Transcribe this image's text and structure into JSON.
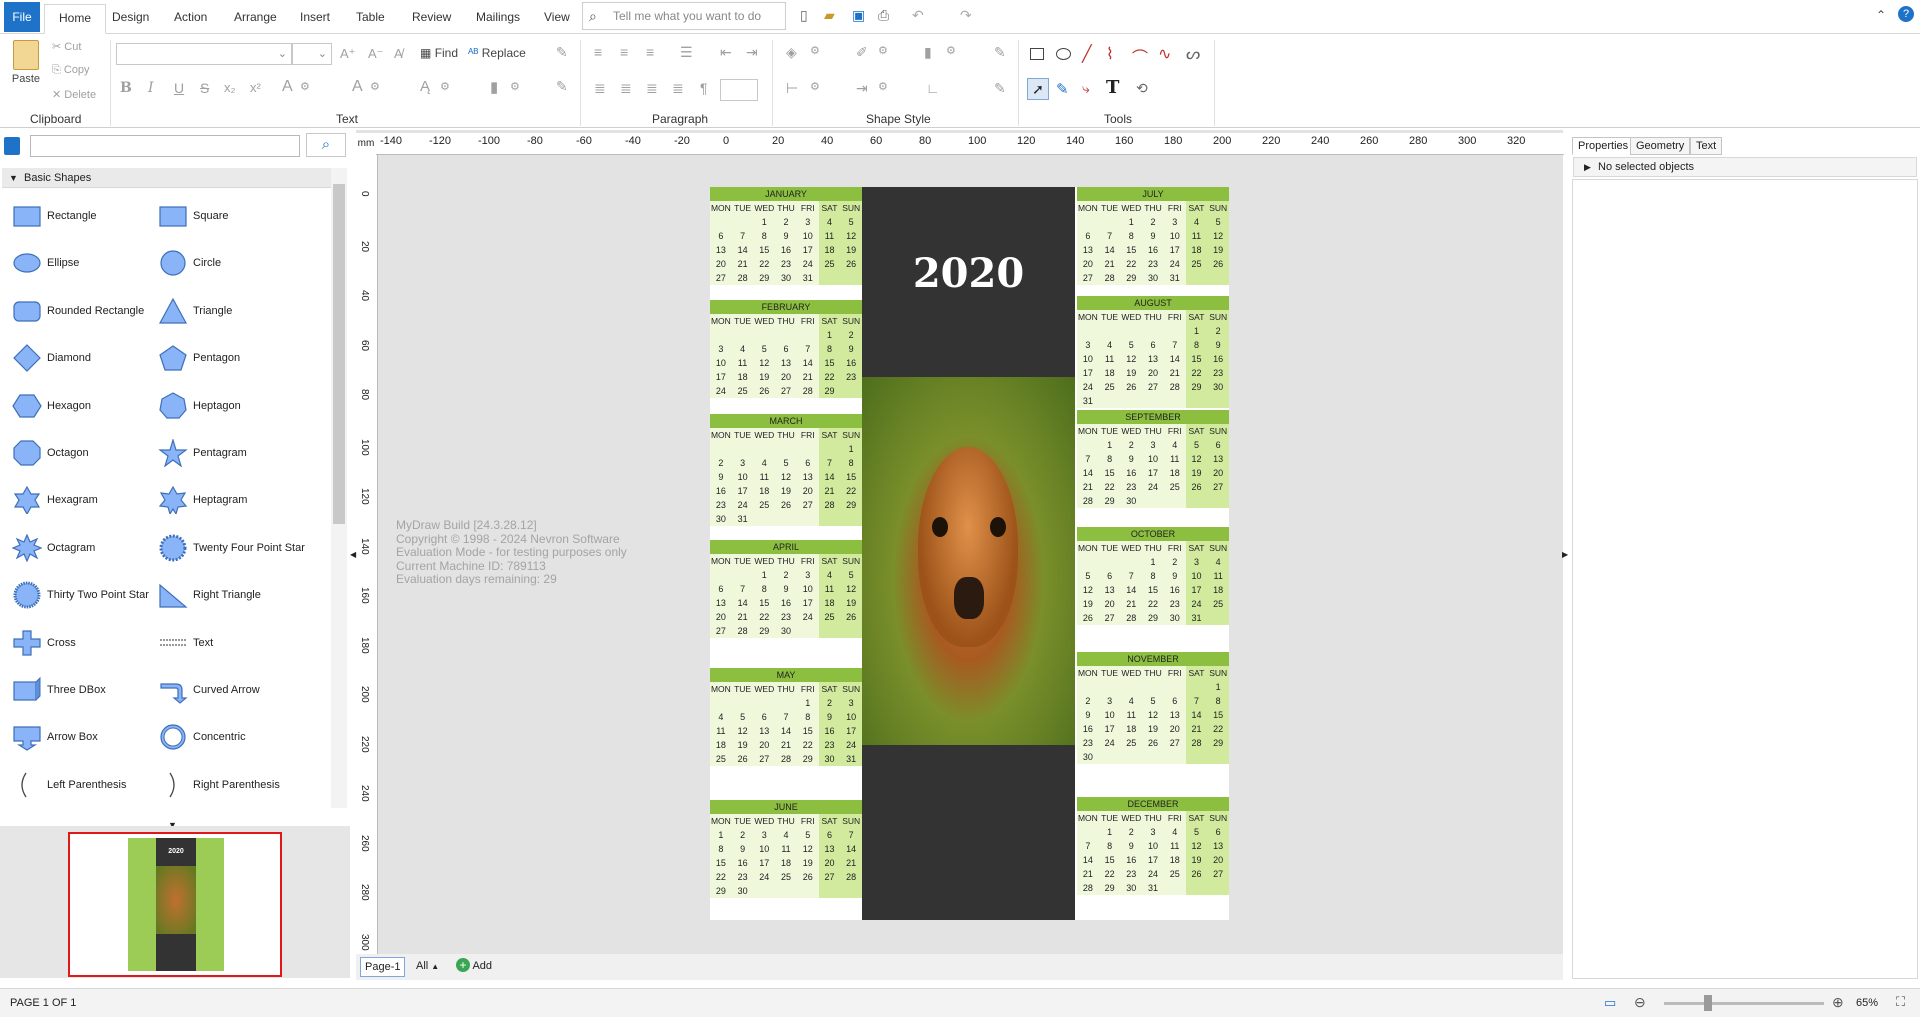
{
  "menu": {
    "file": "File",
    "tabs": [
      "Home",
      "Design",
      "Action",
      "Arrange",
      "Insert",
      "Table",
      "Review",
      "Mailings",
      "View"
    ],
    "tell_me_placeholder": "Tell me what you want to do"
  },
  "ribbon": {
    "clipboard": {
      "paste": "Paste",
      "cut": "Cut",
      "copy": "Copy",
      "delete": "Delete",
      "label": "Clipboard"
    },
    "text": {
      "find": "Find",
      "replace": "Replace",
      "label": "Text"
    },
    "paragraph": {
      "label": "Paragraph"
    },
    "shape_style": {
      "label": "Shape Style"
    },
    "tools": {
      "label": "Tools"
    }
  },
  "library": {
    "search_value": "",
    "header": "Basic Shapes",
    "shapes": [
      {
        "left": "Rectangle",
        "right": "Square"
      },
      {
        "left": "Ellipse",
        "right": "Circle"
      },
      {
        "left": "Rounded Rectangle",
        "right": "Triangle"
      },
      {
        "left": "Diamond",
        "right": "Pentagon"
      },
      {
        "left": "Hexagon",
        "right": "Heptagon"
      },
      {
        "left": "Octagon",
        "right": "Pentagram"
      },
      {
        "left": "Hexagram",
        "right": "Heptagram"
      },
      {
        "left": "Octagram",
        "right": "Twenty Four Point Star"
      },
      {
        "left": "Thirty Two Point Star",
        "right": "Right Triangle"
      },
      {
        "left": "Cross",
        "right": "Text"
      },
      {
        "left": "Three DBox",
        "right": "Curved Arrow"
      },
      {
        "left": "Arrow Box",
        "right": "Concentric"
      },
      {
        "left": "Left Parenthesis",
        "right": "Right Parenthesis"
      }
    ]
  },
  "ruler": {
    "unit": "mm",
    "h_ticks": [
      "-140",
      "-120",
      "-100",
      "-80",
      "-60",
      "-40",
      "-20",
      "0",
      "20",
      "40",
      "60",
      "80",
      "100",
      "120",
      "140",
      "160",
      "180",
      "200",
      "220",
      "240",
      "260",
      "280",
      "300",
      "320"
    ],
    "v_ticks": [
      "0",
      "20",
      "40",
      "60",
      "80",
      "100",
      "120",
      "140",
      "160",
      "180",
      "200",
      "220",
      "240",
      "260",
      "280",
      "300"
    ]
  },
  "calendar": {
    "year": "2020",
    "dow": [
      "MON",
      "TUE",
      "WED",
      "THU",
      "FRI",
      "SAT",
      "SUN"
    ],
    "months": [
      {
        "name": "JANUARY",
        "weeks": [
          [
            "",
            "",
            "1",
            "2",
            "3",
            "4",
            "5"
          ],
          [
            "6",
            "7",
            "8",
            "9",
            "10",
            "11",
            "12"
          ],
          [
            "13",
            "14",
            "15",
            "16",
            "17",
            "18",
            "19"
          ],
          [
            "20",
            "21",
            "22",
            "23",
            "24",
            "25",
            "26"
          ],
          [
            "27",
            "28",
            "29",
            "30",
            "31",
            "",
            ""
          ]
        ]
      },
      {
        "name": "FEBRUARY",
        "weeks": [
          [
            "",
            "",
            "",
            "",
            "",
            "1",
            "2"
          ],
          [
            "3",
            "4",
            "5",
            "6",
            "7",
            "8",
            "9"
          ],
          [
            "10",
            "11",
            "12",
            "13",
            "14",
            "15",
            "16"
          ],
          [
            "17",
            "18",
            "19",
            "20",
            "21",
            "22",
            "23"
          ],
          [
            "24",
            "25",
            "26",
            "27",
            "28",
            "29",
            ""
          ]
        ]
      },
      {
        "name": "MARCH",
        "weeks": [
          [
            "",
            "",
            "",
            "",
            "",
            "",
            "1"
          ],
          [
            "2",
            "3",
            "4",
            "5",
            "6",
            "7",
            "8"
          ],
          [
            "9",
            "10",
            "11",
            "12",
            "13",
            "14",
            "15"
          ],
          [
            "16",
            "17",
            "18",
            "19",
            "20",
            "21",
            "22"
          ],
          [
            "23",
            "24",
            "25",
            "26",
            "27",
            "28",
            "29"
          ],
          [
            "30",
            "31",
            "",
            "",
            "",
            "",
            ""
          ]
        ]
      },
      {
        "name": "APRIL",
        "weeks": [
          [
            "",
            "",
            "1",
            "2",
            "3",
            "4",
            "5"
          ],
          [
            "6",
            "7",
            "8",
            "9",
            "10",
            "11",
            "12"
          ],
          [
            "13",
            "14",
            "15",
            "16",
            "17",
            "18",
            "19"
          ],
          [
            "20",
            "21",
            "22",
            "23",
            "24",
            "25",
            "26"
          ],
          [
            "27",
            "28",
            "29",
            "30",
            "",
            "",
            ""
          ]
        ]
      },
      {
        "name": "MAY",
        "weeks": [
          [
            "",
            "",
            "",
            "",
            "1",
            "2",
            "3"
          ],
          [
            "4",
            "5",
            "6",
            "7",
            "8",
            "9",
            "10"
          ],
          [
            "11",
            "12",
            "13",
            "14",
            "15",
            "16",
            "17"
          ],
          [
            "18",
            "19",
            "20",
            "21",
            "22",
            "23",
            "24"
          ],
          [
            "25",
            "26",
            "27",
            "28",
            "29",
            "30",
            "31"
          ]
        ]
      },
      {
        "name": "JUNE",
        "weeks": [
          [
            "1",
            "2",
            "3",
            "4",
            "5",
            "6",
            "7"
          ],
          [
            "8",
            "9",
            "10",
            "11",
            "12",
            "13",
            "14"
          ],
          [
            "15",
            "16",
            "17",
            "18",
            "19",
            "20",
            "21"
          ],
          [
            "22",
            "23",
            "24",
            "25",
            "26",
            "27",
            "28"
          ],
          [
            "29",
            "30",
            "",
            "",
            "",
            "",
            ""
          ]
        ]
      },
      {
        "name": "JULY",
        "weeks": [
          [
            "",
            "",
            "1",
            "2",
            "3",
            "4",
            "5"
          ],
          [
            "6",
            "7",
            "8",
            "9",
            "10",
            "11",
            "12"
          ],
          [
            "13",
            "14",
            "15",
            "16",
            "17",
            "18",
            "19"
          ],
          [
            "20",
            "21",
            "22",
            "23",
            "24",
            "25",
            "26"
          ],
          [
            "27",
            "28",
            "29",
            "30",
            "31",
            "",
            ""
          ]
        ]
      },
      {
        "name": "AUGUST",
        "weeks": [
          [
            "",
            "",
            "",
            "",
            "",
            "1",
            "2"
          ],
          [
            "3",
            "4",
            "5",
            "6",
            "7",
            "8",
            "9"
          ],
          [
            "10",
            "11",
            "12",
            "13",
            "14",
            "15",
            "16"
          ],
          [
            "17",
            "18",
            "19",
            "20",
            "21",
            "22",
            "23"
          ],
          [
            "24",
            "25",
            "26",
            "27",
            "28",
            "29",
            "30"
          ],
          [
            "31",
            "",
            "",
            "",
            "",
            "",
            ""
          ]
        ]
      },
      {
        "name": "SEPTEMBER",
        "weeks": [
          [
            "",
            "1",
            "2",
            "3",
            "4",
            "5",
            "6"
          ],
          [
            "7",
            "8",
            "9",
            "10",
            "11",
            "12",
            "13"
          ],
          [
            "14",
            "15",
            "16",
            "17",
            "18",
            "19",
            "20"
          ],
          [
            "21",
            "22",
            "23",
            "24",
            "25",
            "26",
            "27"
          ],
          [
            "28",
            "29",
            "30",
            "",
            "",
            "",
            ""
          ]
        ]
      },
      {
        "name": "OCTOBER",
        "weeks": [
          [
            "",
            "",
            "",
            "1",
            "2",
            "3",
            "4"
          ],
          [
            "5",
            "6",
            "7",
            "8",
            "9",
            "10",
            "11"
          ],
          [
            "12",
            "13",
            "14",
            "15",
            "16",
            "17",
            "18"
          ],
          [
            "19",
            "20",
            "21",
            "22",
            "23",
            "24",
            "25"
          ],
          [
            "26",
            "27",
            "28",
            "29",
            "30",
            "31",
            ""
          ]
        ]
      },
      {
        "name": "NOVEMBER",
        "weeks": [
          [
            "",
            "",
            "",
            "",
            "",
            "",
            "1"
          ],
          [
            "2",
            "3",
            "4",
            "5",
            "6",
            "7",
            "8"
          ],
          [
            "9",
            "10",
            "11",
            "12",
            "13",
            "14",
            "15"
          ],
          [
            "16",
            "17",
            "18",
            "19",
            "20",
            "21",
            "22"
          ],
          [
            "23",
            "24",
            "25",
            "26",
            "27",
            "28",
            "29"
          ],
          [
            "30",
            "",
            "",
            "",
            "",
            "",
            ""
          ]
        ]
      },
      {
        "name": "DECEMBER",
        "weeks": [
          [
            "",
            "1",
            "2",
            "3",
            "4",
            "5",
            "6"
          ],
          [
            "7",
            "8",
            "9",
            "10",
            "11",
            "12",
            "13"
          ],
          [
            "14",
            "15",
            "16",
            "17",
            "18",
            "19",
            "20"
          ],
          [
            "21",
            "22",
            "23",
            "24",
            "25",
            "26",
            "27"
          ],
          [
            "28",
            "29",
            "30",
            "31",
            "",
            "",
            ""
          ]
        ]
      }
    ]
  },
  "watermark": [
    "MyDraw Build [24.3.28.12]",
    "Copyright © 1998 - 2024 Nevron Software",
    "Evaluation Mode - for testing purposes only",
    "Current Machine ID: 789113",
    "Evaluation days remaining: 29"
  ],
  "pages": {
    "current": "Page-1",
    "all": "All",
    "add": "Add"
  },
  "properties": {
    "tabs": [
      "Properties",
      "Geometry",
      "Text"
    ],
    "no_selection": "No selected objects"
  },
  "status": {
    "page": "PAGE 1 OF 1",
    "zoom": "65%"
  },
  "colors": {
    "accent": "#1e73c8",
    "calendar_header": "#8cbf3f",
    "weekend": "#d2ea9e",
    "selection": "#e01818"
  }
}
